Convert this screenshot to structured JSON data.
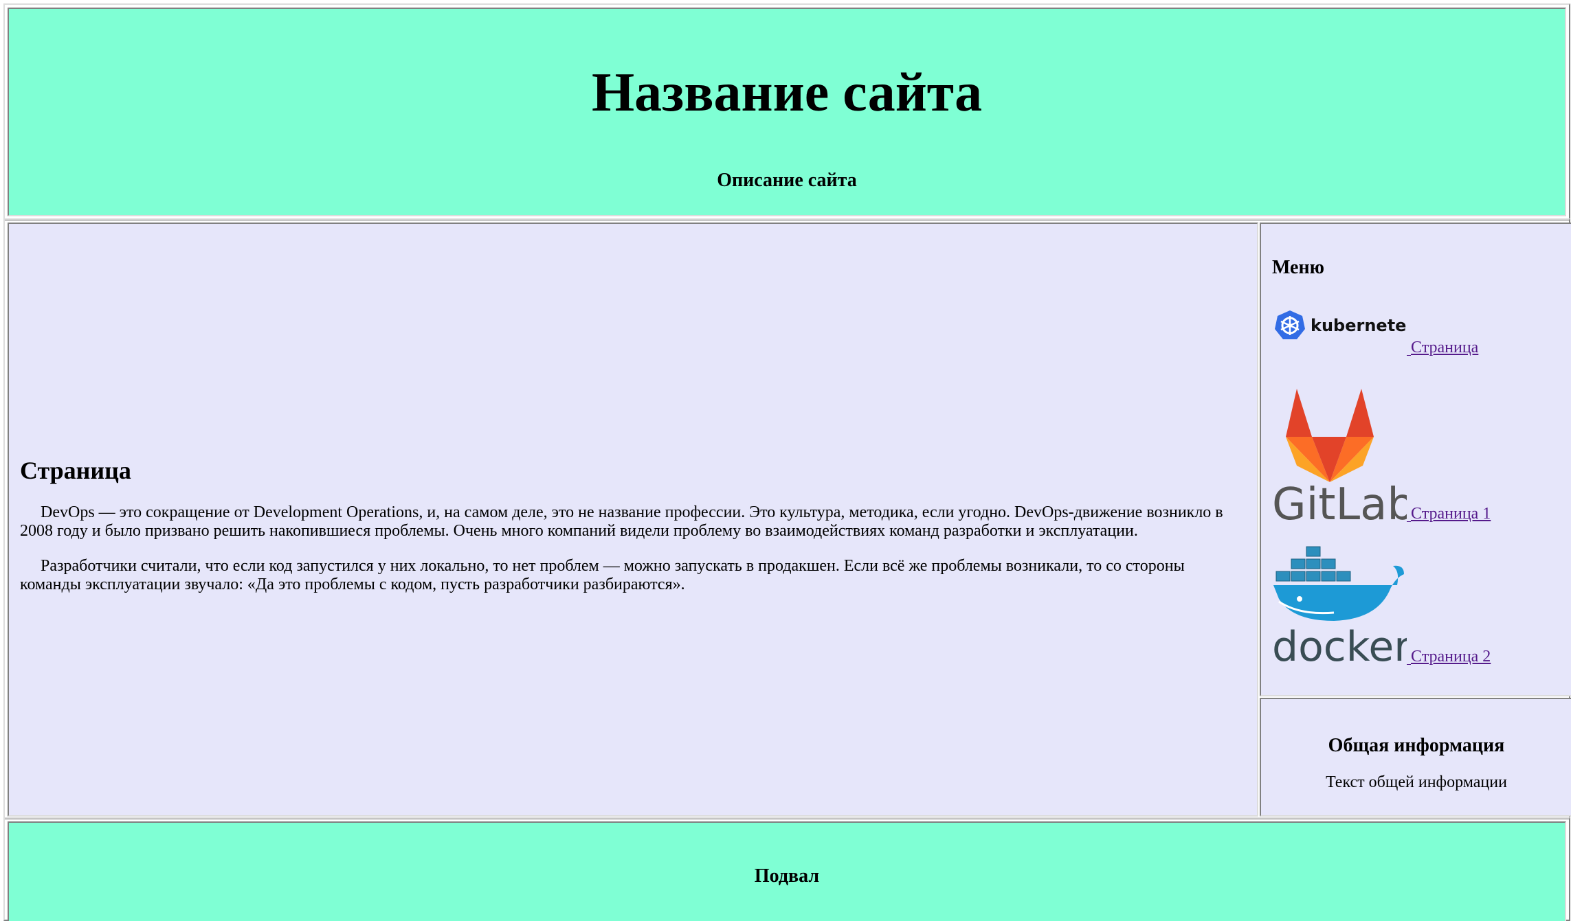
{
  "header": {
    "title": "Название сайта",
    "description": "Описание сайта"
  },
  "main": {
    "heading": "Страница",
    "paragraphs": [
      "DevOps — это сокращение от Development Operations, и, на самом деле, это не название профессии. Это культура, методика, если угодно. DevOps-движение возникло в 2008 году и было призвано решить накопившиеся проблемы. Очень много компаний видели проблему во взаимодействиях команд разработки и эксплуатации.",
      "Разработчики считали, что если код запустился у них локально, то нет проблем — можно запускать в продакшен. Если всё же проблемы возникали, то со стороны команды эксплуатации звучало: «Да это проблемы с кодом, пусть разработчики разбираются»."
    ]
  },
  "menu": {
    "heading": "Меню",
    "items": [
      {
        "logo": "kubernetes",
        "logo_text": "kubernetes",
        "label": "Страница"
      },
      {
        "logo": "gitlab",
        "logo_text": "GitLab",
        "label": "Страница 1"
      },
      {
        "logo": "docker",
        "logo_text": "docker",
        "label": "Страница 2"
      }
    ]
  },
  "info": {
    "heading": "Общая информация",
    "text": "Текст общей информации"
  },
  "footer": {
    "text": "Подвал"
  },
  "colors": {
    "header_bg": "#7fffd4",
    "content_bg": "#e6e6fa",
    "link": "#551a8b"
  }
}
